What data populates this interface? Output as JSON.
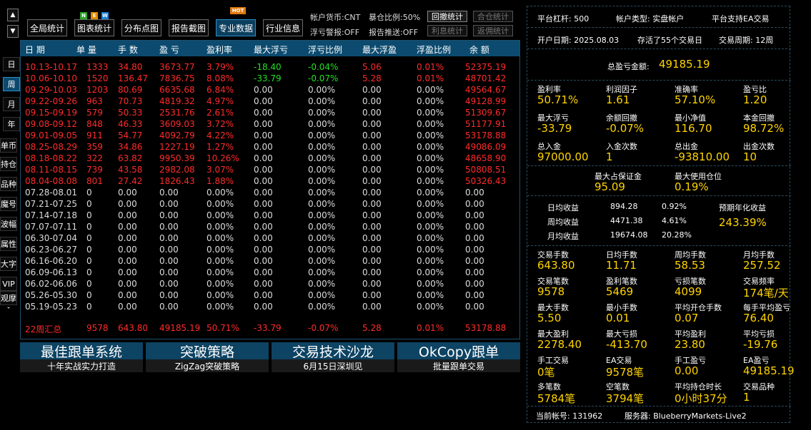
{
  "nav": {
    "up": "▲",
    "down": "▼",
    "items": [
      "日",
      "周",
      "月",
      "年",
      "单币",
      "持仓",
      "品种",
      "魔号",
      "波幅",
      "属性",
      "大字",
      "VIP",
      "观摩"
    ],
    "more": "ˇ"
  },
  "toolbar": {
    "buttons": [
      "全局统计",
      "图表统计",
      "分布点图",
      "报告截图",
      "专业数据",
      "行业信息"
    ],
    "new_badge": [
      "N",
      "E",
      "W"
    ],
    "hot_badge": "HOT",
    "currency": "帐户货币:CNT",
    "exposure": "暴仓比例:50%",
    "float_alert": "浮亏警报:OFF",
    "report_push": "报告推送:OFF",
    "small_buttons": [
      "回撤统计",
      "合仓统计",
      "利息统计",
      "返佣统计"
    ]
  },
  "table": {
    "headers": [
      "日 期",
      "单 量",
      "手 数",
      "盈 亏",
      "盈利率",
      "最大浮亏",
      "浮亏比例",
      "最大浮盈",
      "浮盈比例",
      "余 额"
    ],
    "rows": [
      [
        "10.13-10.17",
        "1333",
        "34.80",
        "3673.77",
        "3.79%",
        "-18.40",
        "-0.04%",
        "5.06",
        "0.01%",
        "52375.19"
      ],
      [
        "10.06-10.10",
        "1520",
        "136.47",
        "7836.75",
        "8.08%",
        "-33.79",
        "-0.07%",
        "5.28",
        "0.01%",
        "48701.42"
      ],
      [
        "09.29-10.03",
        "1203",
        "80.69",
        "6635.68",
        "6.84%",
        "0.00",
        "0.00%",
        "0.00",
        "0.00%",
        "49564.67"
      ],
      [
        "09.22-09.26",
        "963",
        "70.73",
        "4819.32",
        "4.97%",
        "0.00",
        "0.00%",
        "0.00",
        "0.00%",
        "49128.99"
      ],
      [
        "09.15-09.19",
        "579",
        "50.33",
        "2531.76",
        "2.61%",
        "0.00",
        "0.00%",
        "0.00",
        "0.00%",
        "51309.67"
      ],
      [
        "09.08-09.12",
        "848",
        "46.33",
        "3609.03",
        "3.72%",
        "0.00",
        "0.00%",
        "0.00",
        "0.00%",
        "51177.91"
      ],
      [
        "09.01-09.05",
        "911",
        "54.77",
        "4092.79",
        "4.22%",
        "0.00",
        "0.00%",
        "0.00",
        "0.00%",
        "53178.88"
      ],
      [
        "08.25-08.29",
        "359",
        "34.86",
        "1227.19",
        "1.27%",
        "0.00",
        "0.00%",
        "0.00",
        "0.00%",
        "49086.09"
      ],
      [
        "08.18-08.22",
        "322",
        "63.82",
        "9950.39",
        "10.26%",
        "0.00",
        "0.00%",
        "0.00",
        "0.00%",
        "48658.90"
      ],
      [
        "08.11-08.15",
        "739",
        "43.58",
        "2982.08",
        "3.07%",
        "0.00",
        "0.00%",
        "0.00",
        "0.00%",
        "50808.51"
      ],
      [
        "08.04-08.08",
        "801",
        "27.42",
        "1826.43",
        "1.88%",
        "0.00",
        "0.00%",
        "0.00",
        "0.00%",
        "50326.43"
      ],
      [
        "07.28-08.01",
        "0",
        "0.00",
        "0.00",
        "0.00%",
        "0.00",
        "0.00%",
        "0.00",
        "0.00%",
        "0.00"
      ],
      [
        "07.21-07.25",
        "0",
        "0.00",
        "0.00",
        "0.00%",
        "0.00",
        "0.00%",
        "0.00",
        "0.00%",
        "0.00"
      ],
      [
        "07.14-07.18",
        "0",
        "0.00",
        "0.00",
        "0.00%",
        "0.00",
        "0.00%",
        "0.00",
        "0.00%",
        "0.00"
      ],
      [
        "07.07-07.11",
        "0",
        "0.00",
        "0.00",
        "0.00%",
        "0.00",
        "0.00%",
        "0.00",
        "0.00%",
        "0.00"
      ],
      [
        "06.30-07.04",
        "0",
        "0.00",
        "0.00",
        "0.00%",
        "0.00",
        "0.00%",
        "0.00",
        "0.00%",
        "0.00"
      ],
      [
        "06.23-06.27",
        "0",
        "0.00",
        "0.00",
        "0.00%",
        "0.00",
        "0.00%",
        "0.00",
        "0.00%",
        "0.00"
      ],
      [
        "06.16-06.20",
        "0",
        "0.00",
        "0.00",
        "0.00%",
        "0.00",
        "0.00%",
        "0.00",
        "0.00%",
        "0.00"
      ],
      [
        "06.09-06.13",
        "0",
        "0.00",
        "0.00",
        "0.00%",
        "0.00",
        "0.00%",
        "0.00",
        "0.00%",
        "0.00"
      ],
      [
        "06.02-06.06",
        "0",
        "0.00",
        "0.00",
        "0.00%",
        "0.00",
        "0.00%",
        "0.00",
        "0.00%",
        "0.00"
      ],
      [
        "05.26-05.30",
        "0",
        "0.00",
        "0.00",
        "0.00%",
        "0.00",
        "0.00%",
        "0.00",
        "0.00%",
        "0.00"
      ],
      [
        "05.19-05.23",
        "0",
        "0.00",
        "0.00",
        "0.00%",
        "0.00",
        "0.00%",
        "0.00",
        "0.00%",
        "0.00"
      ]
    ],
    "summary": [
      "22周汇总",
      "9578",
      "643.80",
      "49185.19",
      "50.71%",
      "-33.79",
      "-0.07%",
      "5.28",
      "0.01%",
      "53178.88"
    ]
  },
  "banners": [
    {
      "title": "最佳跟单系统",
      "sub": "十年实战实力打造"
    },
    {
      "title": "突破策略",
      "sub": "ZigZag突破策略"
    },
    {
      "title": "交易技术沙龙",
      "sub": "6月15日深圳见"
    },
    {
      "title": "OkCopy跟单",
      "sub": "批量跟单交易"
    }
  ],
  "panel": {
    "leverage": "平台杠杆:  500",
    "acct_type": "帐户类型:  实盘帐户",
    "ea": "平台支持EA交易",
    "open_date": "开户日期:  2025.08.03",
    "survived": "存活了55个交易日",
    "cycle": "交易周期:  12周",
    "total_label": "总盈亏金额:",
    "total_value": "49185.19",
    "grid1": [
      [
        [
          "盈利率",
          "50.71%"
        ],
        [
          "利润因子",
          "1.61"
        ],
        [
          "准确率",
          "57.10%"
        ],
        [
          "盈亏比",
          "1.20"
        ]
      ],
      [
        [
          "最大浮亏",
          "-33.79"
        ],
        [
          "余额回撤",
          "-0.07%"
        ],
        [
          "最小净值",
          "116.70"
        ],
        [
          "本金回撤",
          "98.72%"
        ]
      ],
      [
        [
          "总入金",
          "97000.00"
        ],
        [
          "入金次数",
          "1"
        ],
        [
          "总出金",
          "-93810.00"
        ],
        [
          "出金次数",
          "10"
        ]
      ]
    ],
    "margin": [
      [
        "最大占保证金",
        "95.09"
      ],
      [
        "最大使用仓位",
        "0.19%"
      ]
    ],
    "avg": [
      [
        "日均收益",
        "894.28",
        "0.92%"
      ],
      [
        "周均收益",
        "4471.38",
        "4.61%"
      ],
      [
        "月均收益",
        "19674.08",
        "20.28%"
      ]
    ],
    "annual_label": "预期年化收益",
    "annual_value": "243.39%",
    "grid2": [
      [
        [
          "交易手数",
          "643.80"
        ],
        [
          "日均手数",
          "11.71"
        ],
        [
          "周均手数",
          "58.53"
        ],
        [
          "月均手数",
          "257.52"
        ]
      ],
      [
        [
          "交易笔数",
          "9578"
        ],
        [
          "盈利笔数",
          "5469"
        ],
        [
          "亏损笔数",
          "4099"
        ],
        [
          "交易频率",
          "174笔/天"
        ]
      ],
      [
        [
          "最大手数",
          "5.50"
        ],
        [
          "最小手数",
          "0.01"
        ],
        [
          "平均开仓手数",
          "0.07"
        ],
        [
          "每手平均盈亏",
          "76.40"
        ]
      ],
      [
        [
          "最大盈利",
          "2278.40"
        ],
        [
          "最大亏损",
          "-413.70"
        ],
        [
          "平均盈利",
          "23.80"
        ],
        [
          "平均亏损",
          "-19.76"
        ]
      ],
      [
        [
          "手工交易",
          "0笔"
        ],
        [
          "EA交易",
          "9578笔"
        ],
        [
          "手工盈亏",
          "0.00"
        ],
        [
          "EA盈亏",
          "49185.19"
        ]
      ],
      [
        [
          "多笔数",
          "5784笔"
        ],
        [
          "空笔数",
          "3794笔"
        ],
        [
          "平均持仓时长",
          "0小时37分"
        ],
        [
          "交易品种",
          "1"
        ]
      ]
    ],
    "account": "当前帐号:  131962",
    "server": "服务器:  BlueberryMarkets-Live2"
  }
}
